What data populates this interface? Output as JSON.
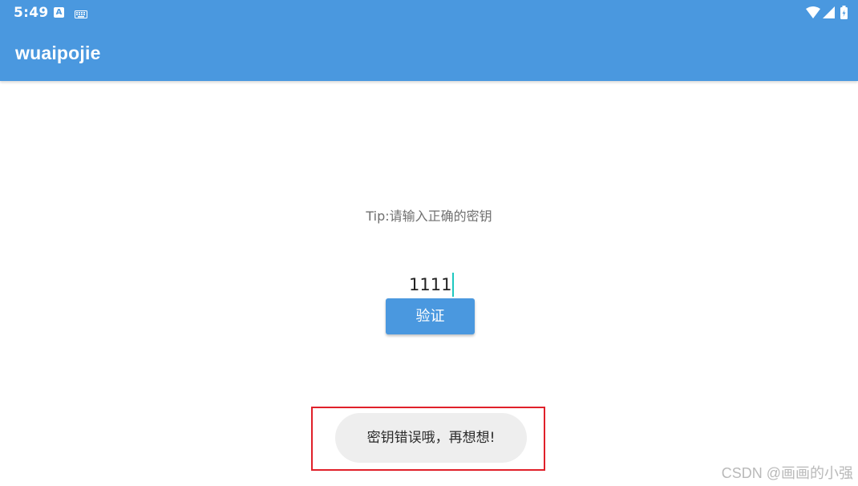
{
  "status_bar": {
    "time": "5:49",
    "notification_letter": "A",
    "icons": [
      "a-notification-icon",
      "keyboard-icon",
      "wifi-icon",
      "signal-icon",
      "battery-icon"
    ]
  },
  "app_bar": {
    "title": "wuaipojie",
    "color": "#4a98df"
  },
  "main": {
    "tip": "Tip:请输入正确的密钥",
    "key_input_value": "1111",
    "verify_button_label": "验证"
  },
  "toast": {
    "message": "密钥错误哦，再想想!",
    "highlight_color": "#e0202a"
  },
  "watermark": "CSDN @画画的小强"
}
